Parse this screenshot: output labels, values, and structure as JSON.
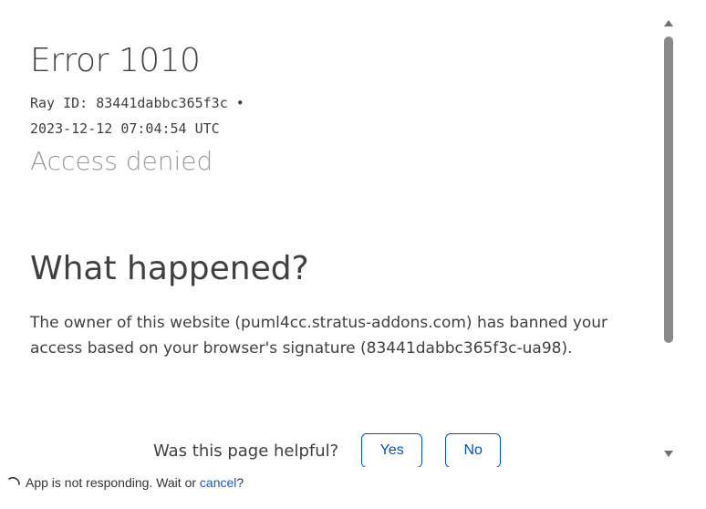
{
  "error": {
    "code_label": "Error 1010",
    "ray_line": "Ray ID: 83441dabbc365f3c •",
    "timestamp": "2023-12-12 07:04:54 UTC",
    "subtitle": "Access denied"
  },
  "what_happened": {
    "heading": "What happened?",
    "body": "The owner of this website (puml4cc.stratus-addons.com) has banned your access based on your browser's signature (83441dabbc365f3c-ua98)."
  },
  "feedback": {
    "question": "Was this page helpful?",
    "yes_label": "Yes",
    "no_label": "No"
  },
  "status_bar": {
    "message": "App is not responding. Wait or",
    "cancel_label": "cancel",
    "suffix": "?"
  },
  "colors": {
    "link": "#0051c3",
    "muted": "#999999",
    "text": "#404040"
  }
}
